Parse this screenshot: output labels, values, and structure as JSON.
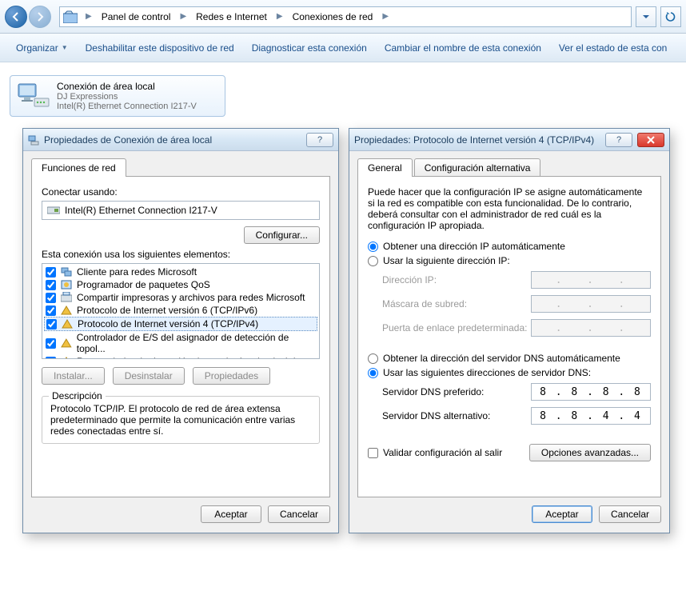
{
  "nav": {
    "crumbs": [
      "Panel de control",
      "Redes e Internet",
      "Conexiones de red"
    ]
  },
  "toolbar": {
    "organize": "Organizar",
    "disable": "Deshabilitar este dispositivo de red",
    "diagnose": "Diagnosticar esta conexión",
    "rename": "Cambiar el nombre de esta conexión",
    "status": "Ver el estado de esta con"
  },
  "item": {
    "title": "Conexión de área local",
    "network": "DJ Expressions",
    "adapter": "Intel(R) Ethernet Connection I217-V"
  },
  "dlg1": {
    "title": "Propiedades de Conexión de área local",
    "tab": "Funciones de red",
    "connect_using": "Conectar usando:",
    "adapter": "Intel(R) Ethernet Connection I217-V",
    "configure": "Configurar...",
    "uses_items": "Esta conexión usa los siguientes elementos:",
    "items": [
      "Cliente para redes Microsoft",
      "Programador de paquetes QoS",
      "Compartir impresoras y archivos para redes Microsoft",
      "Protocolo de Internet versión 6 (TCP/IPv6)",
      "Protocolo de Internet versión 4 (TCP/IPv4)",
      "Controlador de E/S del asignador de detección de topol...",
      "Respondedor de detección de topologías de nivel de v..."
    ],
    "install": "Instalar...",
    "uninstall": "Desinstalar",
    "properties": "Propiedades",
    "desc_h": "Descripción",
    "desc": "Protocolo TCP/IP. El protocolo de red de área extensa predeterminado que permite la comunicación entre varias redes conectadas entre sí.",
    "ok": "Aceptar",
    "cancel": "Cancelar"
  },
  "dlg2": {
    "title": "Propiedades: Protocolo de Internet versión 4 (TCP/IPv4)",
    "tab1": "General",
    "tab2": "Configuración alternativa",
    "intro": "Puede hacer que la configuración IP se asigne automáticamente si la red es compatible con esta funcionalidad. De lo contrario, deberá consultar con el administrador de red cuál es la configuración IP apropiada.",
    "r_auto_ip": "Obtener una dirección IP automáticamente",
    "r_man_ip": "Usar la siguiente dirección IP:",
    "ip_lbl": "Dirección IP:",
    "mask_lbl": "Máscara de subred:",
    "gw_lbl": "Puerta de enlace predeterminada:",
    "r_auto_dns": "Obtener la dirección del servidor DNS automáticamente",
    "r_man_dns": "Usar las siguientes direcciones de servidor DNS:",
    "dns1_lbl": "Servidor DNS preferido:",
    "dns2_lbl": "Servidor DNS alternativo:",
    "dns1": "8 . 8 . 8 . 8",
    "dns2": "8 . 8 . 4 . 4",
    "validate": "Validar configuración al salir",
    "advanced": "Opciones avanzadas...",
    "ok": "Aceptar",
    "cancel": "Cancelar"
  }
}
